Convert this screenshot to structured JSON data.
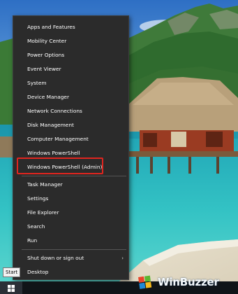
{
  "menu": {
    "group1": [
      "Apps and Features",
      "Mobility Center",
      "Power Options",
      "Event Viewer",
      "System",
      "Device Manager",
      "Network Connections",
      "Disk Management",
      "Computer Management",
      "Windows PowerShell",
      "Windows PowerShell (Admin)"
    ],
    "group2": [
      "Task Manager",
      "Settings",
      "File Explorer",
      "Search",
      "Run"
    ],
    "group3": [
      "Shut down or sign out",
      "Desktop"
    ],
    "submenu_arrow": "›",
    "highlight_color": "#e0251f"
  },
  "taskbar": {
    "start_tooltip": "Start",
    "start_icon": "windows-logo-icon"
  },
  "watermark": {
    "text": "WinBuzzer"
  },
  "colors": {
    "menu_background": "#2b2b2b",
    "menu_text": "#ffffff",
    "taskbar": "#101418"
  }
}
